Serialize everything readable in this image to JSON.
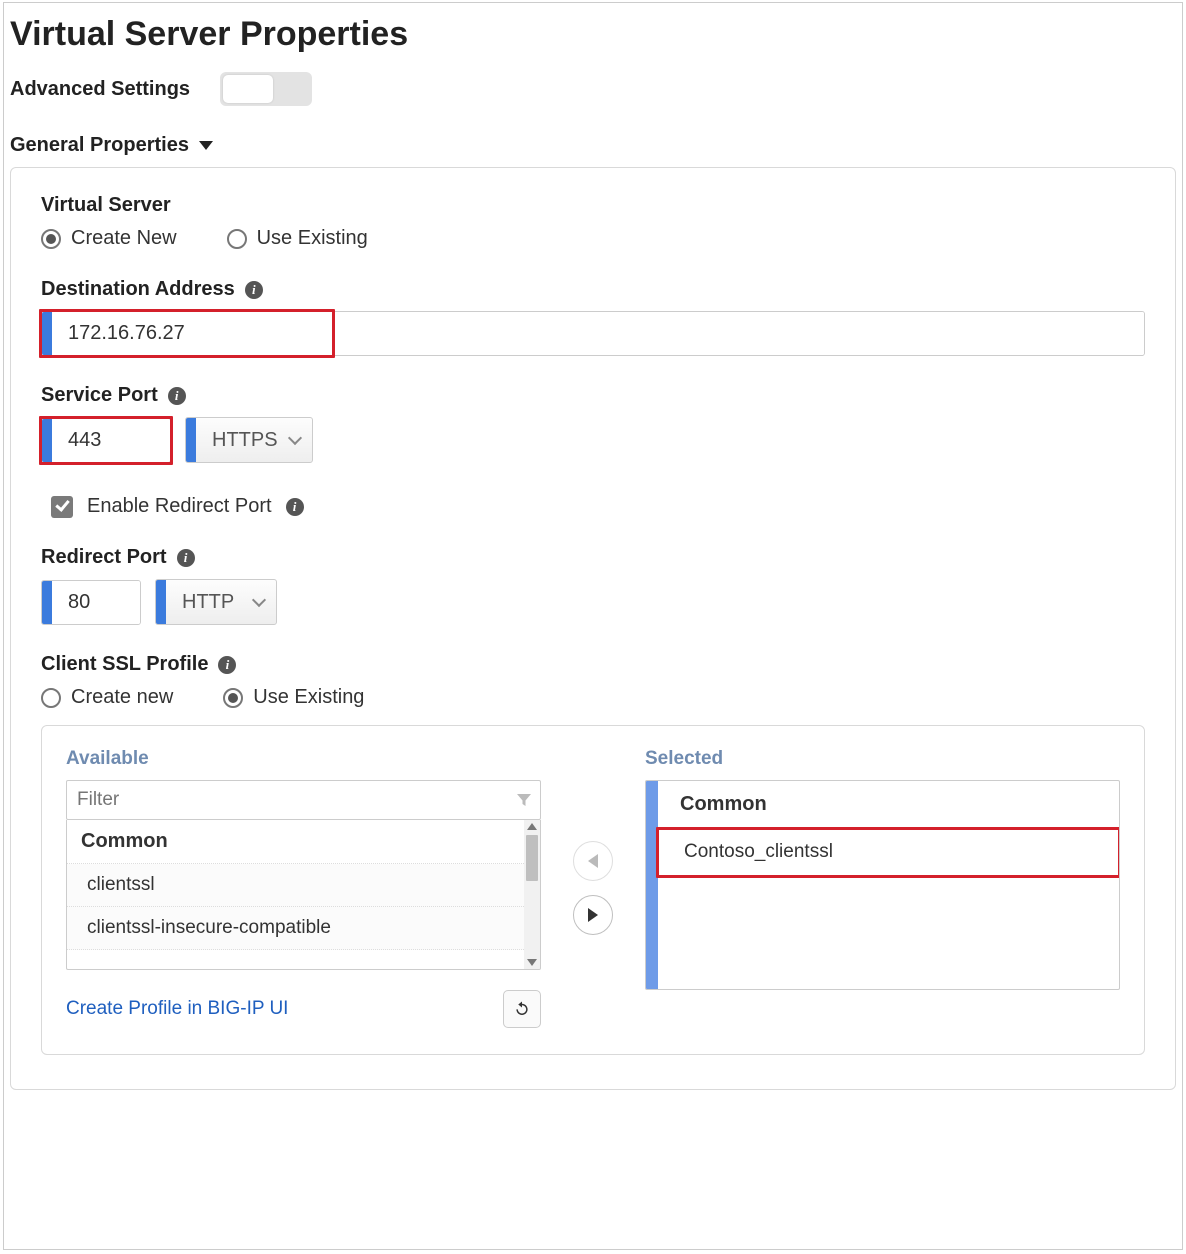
{
  "pageTitle": "Virtual Server Properties",
  "advancedSettingsLabel": "Advanced Settings",
  "section": {
    "title": "General Properties"
  },
  "virtualServer": {
    "label": "Virtual Server",
    "createNew": "Create New",
    "useExisting": "Use Existing"
  },
  "destination": {
    "label": "Destination Address",
    "value": "172.16.76.27"
  },
  "servicePort": {
    "label": "Service Port",
    "value": "443",
    "protocol": "HTTPS"
  },
  "redirectEnable": {
    "label": "Enable Redirect Port"
  },
  "redirectPort": {
    "label": "Redirect Port",
    "value": "80",
    "protocol": "HTTP"
  },
  "clientSsl": {
    "label": "Client SSL Profile",
    "createNew": "Create new",
    "useExisting": "Use Existing"
  },
  "transfer": {
    "availableTitle": "Available",
    "selectedTitle": "Selected",
    "filterPlaceholder": "Filter",
    "groupName": "Common",
    "availableItems": [
      "clientssl",
      "clientssl-insecure-compatible"
    ],
    "selectedItems": [
      "Contoso_clientssl"
    ],
    "createProfileLink": "Create Profile in BIG-IP UI"
  }
}
